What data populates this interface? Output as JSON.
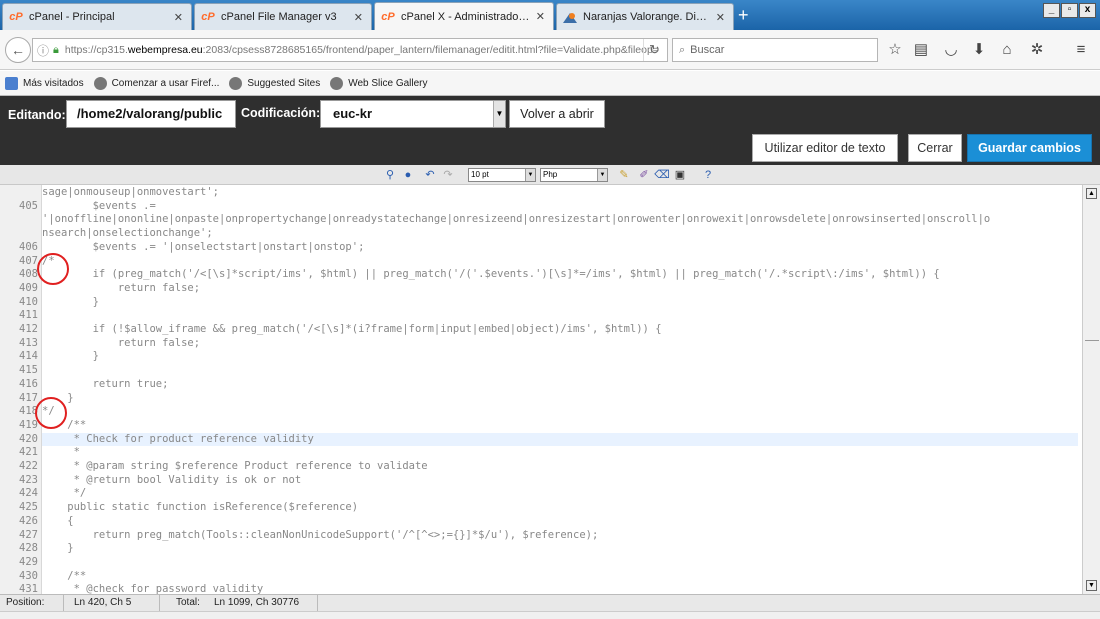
{
  "browser": {
    "tabs": [
      {
        "title": "cPanel - Principal",
        "icon": "cpanel-icon",
        "active": false
      },
      {
        "title": "cPanel File Manager v3",
        "icon": "cpanel-icon",
        "active": false
      },
      {
        "title": "cPanel X - Administrador de a...",
        "icon": "cpanel-icon",
        "active": true
      },
      {
        "title": "Naranjas Valorange. Directas ...",
        "icon": "valorange-icon",
        "active": false
      }
    ],
    "favicon_text": "cP",
    "new_tab": "+",
    "url_prefix": "https://cp315.",
    "url_host": "webempresa.eu",
    "url_rest": ":2083/cpsess8728685165/frontend/paper_lantern/filemanager/editit.html?file=Validate.php&fileop=",
    "search_placeholder": "Buscar",
    "bookmarks": [
      "Más visitados",
      "Comenzar a usar Firef...",
      "Suggested Sites",
      "Web Slice Gallery"
    ]
  },
  "editor_header": {
    "editing_label": "Editando:",
    "path": "/home2/valorang/public",
    "encoding_label": "Codificación:",
    "encoding_value": "euc-kr",
    "reopen_button": "Volver a abrir",
    "text_editor_button": "Utilizar editor de texto",
    "close_button": "Cerrar",
    "save_button": "Guardar cambios"
  },
  "toolbar": {
    "font_size": "10 pt",
    "syntax": "Php"
  },
  "code_lines": [
    {
      "num": "",
      "text": "sage|onmouseup|onmovestart';",
      "cls": "k-blue"
    },
    {
      "num": "405",
      "text": "        $events .=",
      "cls": "k-blue"
    },
    {
      "num": "",
      "text": "'|onoffline|ononline|onpaste|onpropertychange|onreadystatechange|onresizeend|onresizestart|onrowenter|onrowexit|onrowsdelete|onrowsinserted|onscroll|o",
      "cls": "k-blue"
    },
    {
      "num": "",
      "text": "nsearch|onselectionchange';",
      "cls": "k-blue"
    },
    {
      "num": "406",
      "text": "        $events .= '|onselectstart|onstart|onstop';",
      "cls": "k-blue"
    },
    {
      "num": "407",
      "text": "/*",
      "cls": "k-plain"
    },
    {
      "num": "408",
      "text": "        if (preg_match('/<[\\s]*script/ims', $html) || preg_match('/('.$events.')[\\s]*=/ims', $html) || preg_match('/.*script\\:/ims', $html)) {",
      "cls": "k-plain"
    },
    {
      "num": "409",
      "text": "            return false;",
      "cls": "k-plain"
    },
    {
      "num": "410",
      "text": "        }",
      "cls": "k-plain"
    },
    {
      "num": "411",
      "text": "",
      "cls": "k-plain"
    },
    {
      "num": "412",
      "text": "        if (!$allow_iframe && preg_match('/<[\\s]*(i?frame|form|input|embed|object)/ims', $html)) {",
      "cls": "k-plain"
    },
    {
      "num": "413",
      "text": "            return false;",
      "cls": "k-plain"
    },
    {
      "num": "414",
      "text": "        }",
      "cls": "k-plain"
    },
    {
      "num": "415",
      "text": "",
      "cls": "k-plain"
    },
    {
      "num": "416",
      "text": "        return true;",
      "cls": "k-plain"
    },
    {
      "num": "417",
      "text": "    }",
      "cls": "k-plain"
    },
    {
      "num": "418",
      "text": "*/",
      "cls": "k-plain"
    },
    {
      "num": "419",
      "text": "    /**",
      "cls": "k-plain"
    },
    {
      "num": "420",
      "text": "     * Check for product reference validity",
      "cls": "k-code",
      "highlight": true
    },
    {
      "num": "421",
      "text": "     *",
      "cls": "k-plain"
    },
    {
      "num": "422",
      "text": "     * @param string $reference Product reference to validate",
      "cls": "k-plain"
    },
    {
      "num": "423",
      "text": "     * @return bool Validity is ok or not",
      "cls": "k-plain"
    },
    {
      "num": "424",
      "text": "     */",
      "cls": "k-plain"
    },
    {
      "num": "425",
      "text": "    public static function isReference($reference)",
      "cls": "k-code"
    },
    {
      "num": "426",
      "text": "    {",
      "cls": "k-kw"
    },
    {
      "num": "427",
      "text": "        return preg_match(Tools::cleanNonUnicodeSupport('/^[^<>;={}]*$/u'), $reference);",
      "cls": "k-code"
    },
    {
      "num": "428",
      "text": "    }",
      "cls": "k-kw"
    },
    {
      "num": "429",
      "text": "",
      "cls": "k-plain"
    },
    {
      "num": "430",
      "text": "    /**",
      "cls": "k-plain"
    },
    {
      "num": "431",
      "text": "     * @check for password validity",
      "cls": "k-plain"
    }
  ],
  "status": {
    "position_label": "Position:",
    "position_value": "Ln 420, Ch 5",
    "total_label": "Total:",
    "total_value": "Ln 1099, Ch 30776"
  },
  "colors": {
    "save_button": "#1b8fd6",
    "header_bg": "#2f2f2f",
    "annotation_circle": "#e02020",
    "highlight_line": "#e8f2ff"
  }
}
